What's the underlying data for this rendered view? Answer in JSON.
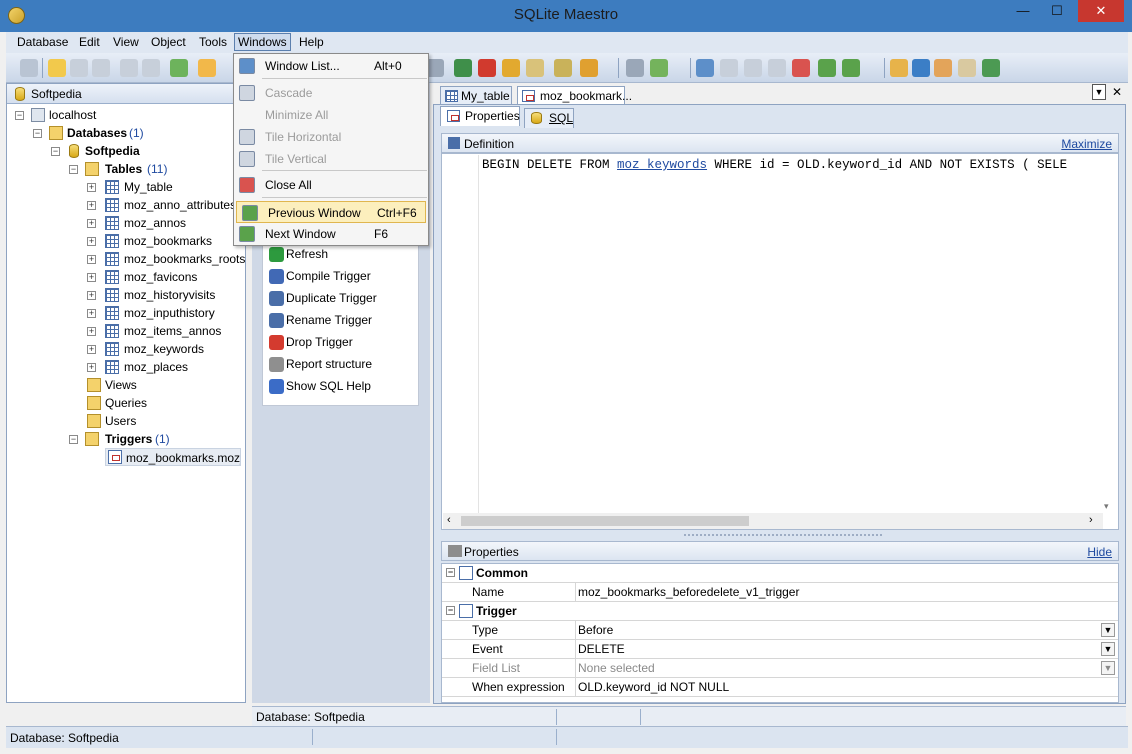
{
  "window": {
    "title": "SQLite Maestro",
    "minimize_icon": "minimize-icon",
    "maximize_icon": "maximize-icon",
    "close_icon": "close-icon",
    "minimize": "—",
    "maximize": "☐",
    "close": "✕"
  },
  "menubar": {
    "items": [
      "Database",
      "Edit",
      "View",
      "Object",
      "Tools",
      "Windows",
      "Help"
    ],
    "active": "Windows"
  },
  "navigator": {
    "title": "Softpedia",
    "tree": {
      "server": "localhost",
      "databases_label": "Databases",
      "databases_count": "(1)",
      "db_name": "Softpedia",
      "tables_label": "Tables",
      "tables_count": "(11)",
      "tables": [
        "My_table",
        "moz_anno_attributes",
        "moz_annos",
        "moz_bookmarks",
        "moz_bookmarks_roots",
        "moz_favicons",
        "moz_historyvisits",
        "moz_inputhistory",
        "moz_items_annos",
        "moz_keywords",
        "moz_places"
      ],
      "views": "Views",
      "queries": "Queries",
      "users": "Users",
      "triggers_label": "Triggers",
      "triggers_count": "(1)",
      "trigger_item": "moz_bookmarks.moz_bo"
    }
  },
  "windows_menu": {
    "items": [
      {
        "label": "Window List...",
        "shortcut": "Alt+0",
        "disabled": false,
        "icon": "window-list-icon"
      },
      {
        "label": "Cascade",
        "shortcut": "",
        "disabled": true,
        "icon": "cascade-icon"
      },
      {
        "label": "Minimize All",
        "shortcut": "",
        "disabled": true,
        "icon": ""
      },
      {
        "label": "Tile Horizontal",
        "shortcut": "",
        "disabled": true,
        "icon": "tile-horizontal-icon"
      },
      {
        "label": "Tile Vertical",
        "shortcut": "",
        "disabled": true,
        "icon": "tile-vertical-icon"
      },
      {
        "label": "Close All",
        "shortcut": "",
        "disabled": false,
        "icon": "close-all-icon"
      },
      {
        "label": "Previous Window",
        "shortcut": "Ctrl+F6",
        "disabled": false,
        "icon": "previous-window-icon",
        "highlighted": true
      },
      {
        "label": "Next Window",
        "shortcut": "F6",
        "disabled": false,
        "icon": "next-window-icon"
      }
    ]
  },
  "actions": [
    {
      "label": "Refresh",
      "icon": "refresh-icon"
    },
    {
      "label": "Compile Trigger",
      "icon": "compile-icon"
    },
    {
      "label": "Duplicate Trigger",
      "icon": "duplicate-icon"
    },
    {
      "label": "Rename Trigger",
      "icon": "rename-icon"
    },
    {
      "label": "Drop Trigger",
      "icon": "drop-icon"
    },
    {
      "label": "Report structure",
      "icon": "report-icon"
    },
    {
      "label": "Show SQL Help",
      "icon": "help-icon"
    }
  ],
  "doc_tabs": [
    {
      "label": "My_table",
      "selected": false
    },
    {
      "label": "moz_bookmark...",
      "selected": true
    }
  ],
  "doc_tab_controls": {
    "dropdown": "▼",
    "close": "✕"
  },
  "sub_tabs": [
    {
      "label": "Properties",
      "selected": true
    },
    {
      "label": "SQL",
      "selected": false
    }
  ],
  "definition": {
    "title": "Definition",
    "maximize_link": "Maximize",
    "code_before": "BEGIN DELETE FROM ",
    "code_link": "moz_keywords",
    "code_after": " WHERE id = OLD.keyword_id AND NOT EXISTS ( SELE"
  },
  "properties": {
    "title": "Properties",
    "hide_link": "Hide",
    "sections": [
      {
        "category": "Common",
        "rows": [
          {
            "key": "Name",
            "value": "moz_bookmarks_beforedelete_v1_trigger",
            "dropdown": false
          }
        ]
      },
      {
        "category": "Trigger",
        "rows": [
          {
            "key": "Type",
            "value": "Before",
            "dropdown": true,
            "disabled": false
          },
          {
            "key": "Event",
            "value": "DELETE",
            "dropdown": true,
            "disabled": false
          },
          {
            "key": "Field List",
            "value": "None selected",
            "dropdown": true,
            "disabled": true
          },
          {
            "key": "When expression",
            "value": "OLD.keyword_id NOT NULL",
            "dropdown": false,
            "disabled": false
          }
        ]
      }
    ]
  },
  "status": {
    "inner": "Database: Softpedia",
    "outer": "Database: Softpedia"
  }
}
